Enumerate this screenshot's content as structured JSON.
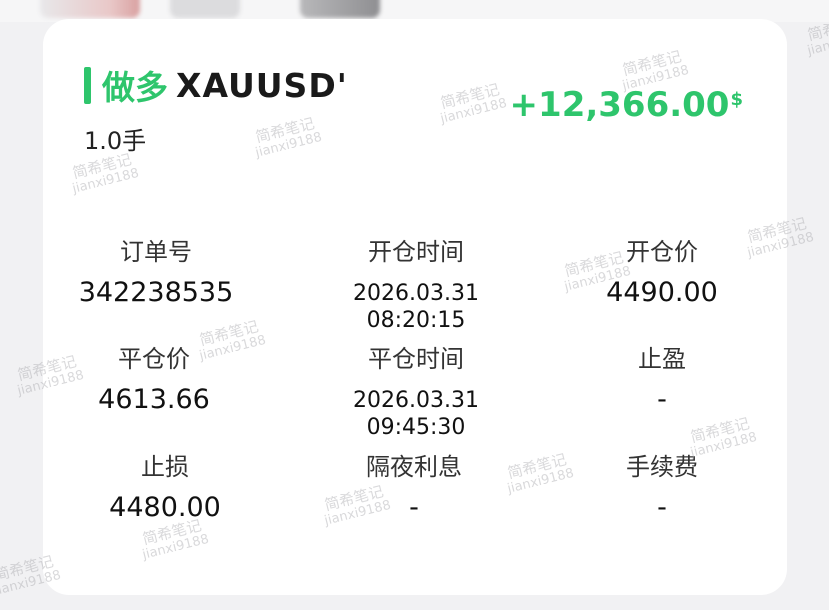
{
  "order": {
    "direction": "做多",
    "symbol": "XAUUSD'",
    "lots": "1.0手",
    "profit": "+12,366.00",
    "profit_currency": "$"
  },
  "fields": [
    {
      "label": "订单号",
      "value": "342238535"
    },
    {
      "label": "开仓时间",
      "value_line1": "2026.03.31",
      "value_line2": "08:20:15"
    },
    {
      "label": "开仓价",
      "value": "4490.00"
    },
    {
      "label": "平仓价",
      "value": "4613.66"
    },
    {
      "label": "平仓时间",
      "value_line1": "2026.03.31",
      "value_line2": "09:45:30"
    },
    {
      "label": "止盈",
      "value": "-"
    },
    {
      "label": "止损",
      "value": "4480.00"
    },
    {
      "label": "隔夜利息",
      "value": "-"
    },
    {
      "label": "手续费",
      "value": "-"
    }
  ],
  "watermark": {
    "line1": "简希笔记",
    "line2": "jianxi9188"
  },
  "colors": {
    "accent_green": "#2ec56c",
    "card_bg": "#ffffff",
    "page_bg": "#f1f1f3"
  }
}
